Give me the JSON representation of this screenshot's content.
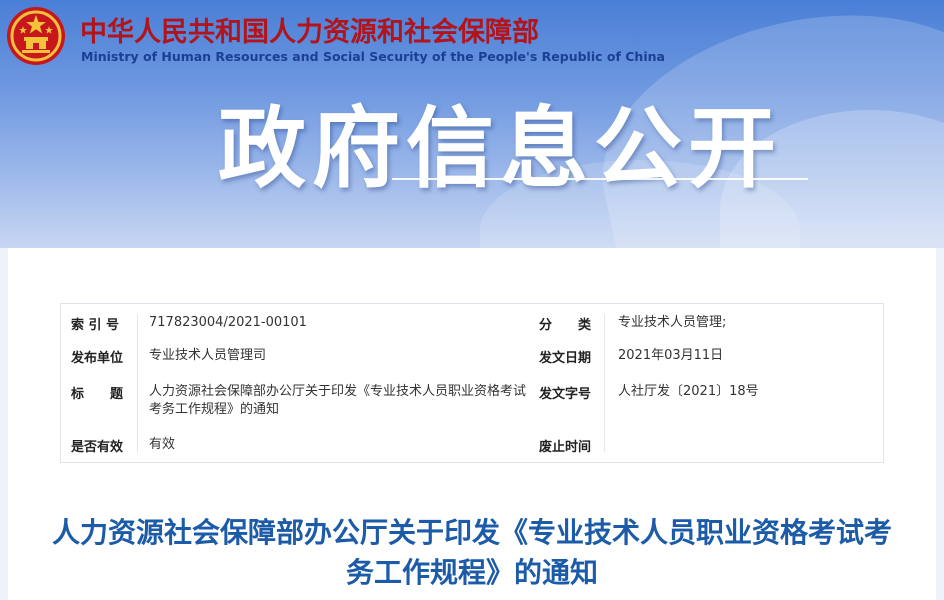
{
  "header": {
    "ministry_cn": "中华人民共和国人力资源和社会保障部",
    "ministry_en": "Ministry of Human Resources and Social Security of the People's Republic of China",
    "section_title": "政府信息公开"
  },
  "colors": {
    "ministry_cn": "#b2141c",
    "ministry_en": "#1b3f94",
    "article_title": "#1c5ba8",
    "banner_top": "#4a7fd6"
  },
  "meta": {
    "index_label": "索 引 号",
    "index_value": "717823004/2021-00101",
    "category_label": "分　　类",
    "category_value": "专业技术人员管理;",
    "publisher_label": "发布单位",
    "publisher_value": "专业技术人员管理司",
    "date_label": "发文日期",
    "date_value": "2021年03月11日",
    "title_label": "标　　题",
    "title_value": "人力资源社会保障部办公厅关于印发《专业技术人员职业资格考试考务工作规程》的通知",
    "doc_no_label": "发文字号",
    "doc_no_value": "人社厅发〔2021〕18号",
    "valid_label": "是否有效",
    "valid_value": "有效",
    "abolish_label": "废止时间",
    "abolish_value": ""
  },
  "article": {
    "title": "人力资源社会保障部办公厅关于印发《专业技术人员职业资格考试考务工作规程》的通知"
  }
}
